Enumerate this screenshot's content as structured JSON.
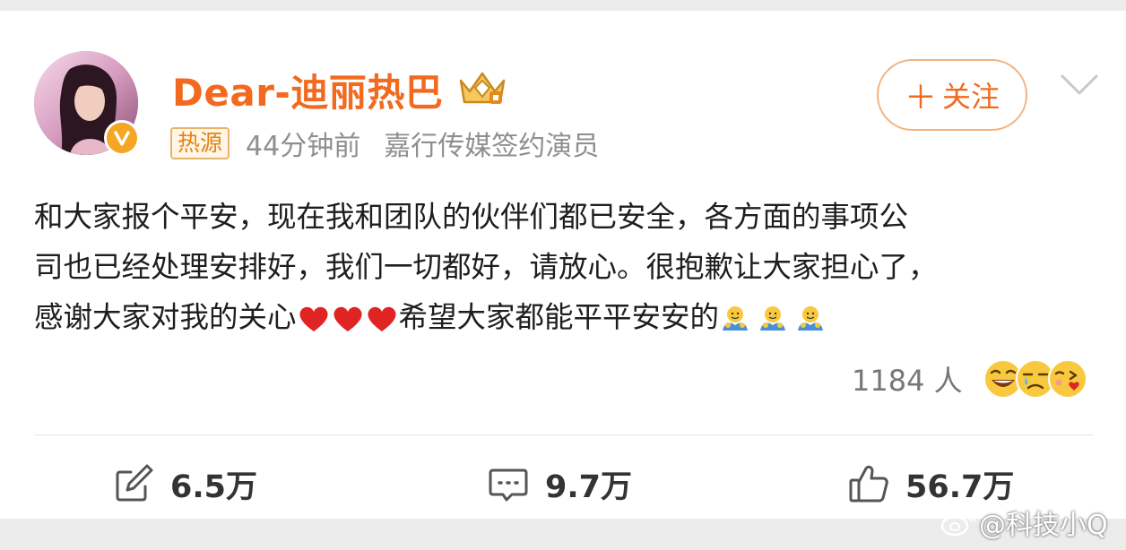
{
  "post": {
    "author": {
      "name": "Dear-迪丽热巴",
      "avatar_icon": "avatar-image",
      "verified_badge_icon": "verified-v-icon",
      "member_badge_icon": "vip-crown-icon",
      "tag": "热源",
      "time": "44分钟前",
      "source": "嘉行传媒签约演员"
    },
    "follow_button": {
      "plus": "＋",
      "label": "关注"
    },
    "more_icon": "chevron-down-icon",
    "text": {
      "line1": "和大家报个平安，现在我和团队的伙伴们都已安全，各方面的事项公",
      "line2": "司也已经处理安排好，我们一切都好，请放心。很抱歉让大家担心了，",
      "line3_a": "感谢大家对我的关心",
      "line3_b": "希望大家都能平平安安的",
      "emoji_heart": "heart-emoji",
      "emoji_hug": "hug-emoji"
    },
    "reactions": {
      "count": "1184 人",
      "faces": [
        "laugh-emoji",
        "tear-emoji",
        "kiss-emoji"
      ]
    },
    "actions": {
      "repost": {
        "icon": "repost-icon",
        "count": "6.5万"
      },
      "comment": {
        "icon": "comment-icon",
        "count": "9.7万"
      },
      "like": {
        "icon": "thumbs-up-icon",
        "count": "56.7万"
      }
    }
  },
  "watermark": {
    "icon": "weibo-logo-icon",
    "text": "@科技小Q"
  },
  "colors": {
    "accent": "#f26a1f",
    "tag_border": "#e7b46d",
    "meta_gray": "#8f8f8f",
    "heart": "#e02424"
  }
}
